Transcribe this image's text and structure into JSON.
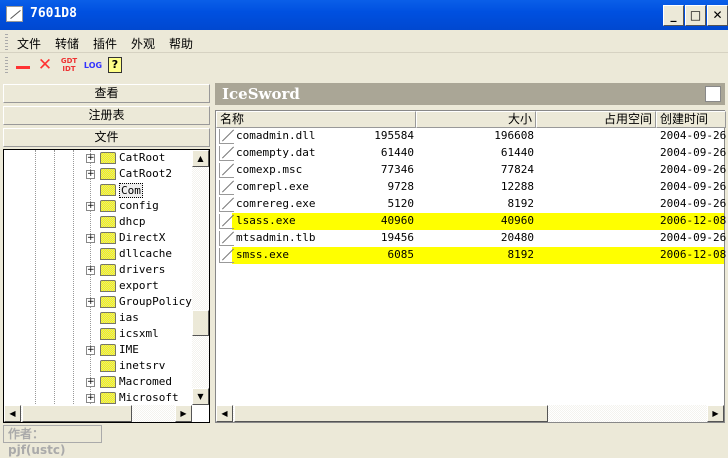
{
  "window": {
    "title": "7601D8"
  },
  "menu": [
    "文件",
    "转储",
    "插件",
    "外观",
    "帮助"
  ],
  "toolbar": {
    "gdt_top": "GDT",
    "gdt_bottom": "IDT",
    "log": "LOG",
    "help": "?"
  },
  "left_buttons": [
    "查看",
    "注册表",
    "文件"
  ],
  "tree": [
    {
      "label": "CatRoot",
      "expand": true
    },
    {
      "label": "CatRoot2",
      "expand": true
    },
    {
      "label": "Com",
      "expand": false,
      "selected": true
    },
    {
      "label": "config",
      "expand": true
    },
    {
      "label": "dhcp",
      "expand": false
    },
    {
      "label": "DirectX",
      "expand": true
    },
    {
      "label": "dllcache",
      "expand": false
    },
    {
      "label": "drivers",
      "expand": true
    },
    {
      "label": "export",
      "expand": false
    },
    {
      "label": "GroupPolicy",
      "expand": true
    },
    {
      "label": "ias",
      "expand": false
    },
    {
      "label": "icsxml",
      "expand": false
    },
    {
      "label": "IME",
      "expand": true
    },
    {
      "label": "inetsrv",
      "expand": false
    },
    {
      "label": "Macromed",
      "expand": true
    },
    {
      "label": "Microsoft",
      "expand": true
    }
  ],
  "panel": {
    "title": "IceSword"
  },
  "columns": [
    "名称",
    "大小",
    "占用空间",
    "创建时间"
  ],
  "files": [
    {
      "name": "comadmin.dll",
      "size": "195584",
      "alloc": "196608",
      "created": "2004-09-26",
      "highlight": false
    },
    {
      "name": "comempty.dat",
      "size": "61440",
      "alloc": "61440",
      "created": "2004-09-26",
      "highlight": false
    },
    {
      "name": "comexp.msc",
      "size": "77346",
      "alloc": "77824",
      "created": "2004-09-26",
      "highlight": false
    },
    {
      "name": "comrepl.exe",
      "size": "9728",
      "alloc": "12288",
      "created": "2004-09-26",
      "highlight": false
    },
    {
      "name": "comrereg.exe",
      "size": "5120",
      "alloc": "8192",
      "created": "2004-09-26",
      "highlight": false
    },
    {
      "name": "lsass.exe",
      "size": "40960",
      "alloc": "40960",
      "created": "2006-12-08",
      "highlight": true
    },
    {
      "name": "mtsadmin.tlb",
      "size": "19456",
      "alloc": "20480",
      "created": "2004-09-26",
      "highlight": false
    },
    {
      "name": "smss.exe",
      "size": "6085",
      "alloc": "8192",
      "created": "2006-12-08",
      "highlight": true
    }
  ],
  "colors": {
    "highlight": "#FFFF00",
    "title_bar": "#0054E3",
    "panel_header": "#AAA696"
  },
  "status": "作者：pjf(ustc)"
}
